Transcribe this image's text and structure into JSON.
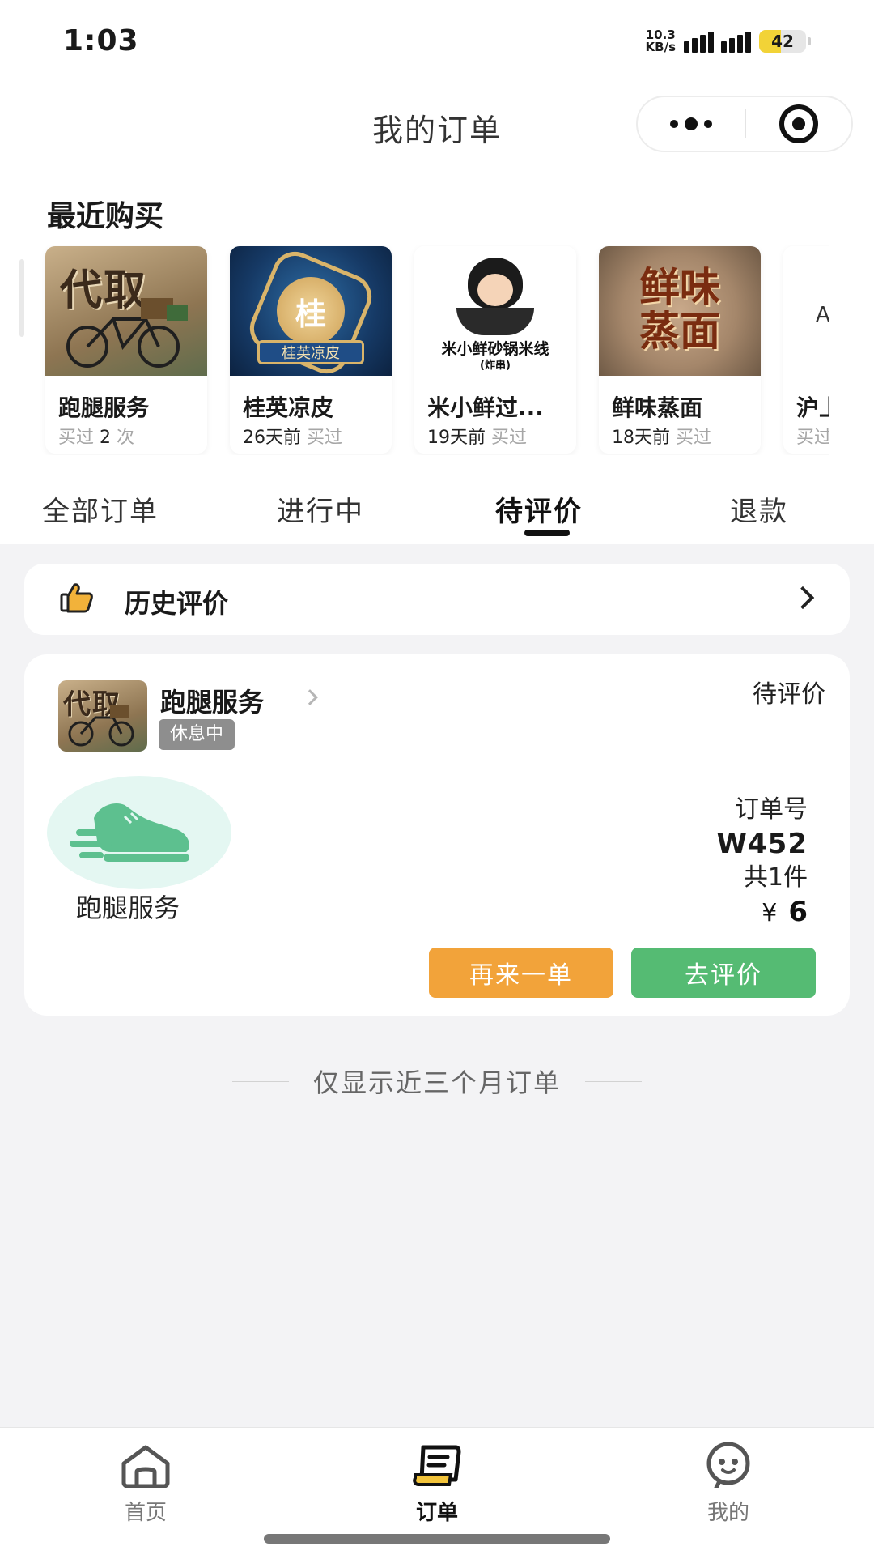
{
  "status_bar": {
    "time": "1:03",
    "net_speed_value": "10.3",
    "net_speed_unit": "KB/s",
    "battery": "42"
  },
  "header": {
    "title": "我的订单"
  },
  "recent": {
    "title": "最近购买",
    "items": [
      {
        "name": "跑腿服务",
        "meta_main": "",
        "meta_muted": "买过 ",
        "meta_count": "2",
        "meta_tail": " 次",
        "thumb_text": "代取"
      },
      {
        "name": "桂英凉皮",
        "meta_main": "26天前",
        "meta_muted": "买过",
        "thumb_text": "桂",
        "thumb_banner": "桂英凉皮"
      },
      {
        "name": "米小鲜过...",
        "meta_main": "19天前",
        "meta_muted": "买过",
        "thumb_text": "米小鲜砂锅米线",
        "thumb_sub": "(炸串)"
      },
      {
        "name": "鲜味蒸面",
        "meta_main": "18天前",
        "meta_muted": "买过",
        "thumb_text": "鲜味蒸面"
      },
      {
        "name": "沪上",
        "meta_main": "",
        "meta_muted": "买过"
      }
    ]
  },
  "tabs": [
    {
      "label": "全部订单"
    },
    {
      "label": "进行中"
    },
    {
      "label": "待评价"
    },
    {
      "label": "退款"
    }
  ],
  "history": {
    "label": "历史评价"
  },
  "order": {
    "shop_name": "跑腿服务",
    "shop_badge": "休息中",
    "shop_logo_text": "代取",
    "status": "待评价",
    "item_name": "跑腿服务",
    "order_no_label": "订单号",
    "order_no": "W452",
    "count": "共1件",
    "currency": "¥",
    "price": "6",
    "btn_reorder": "再来一单",
    "btn_review": "去评价"
  },
  "footer_note": "仅显示近三个月订单",
  "tabbar": [
    {
      "label": "首页",
      "icon": "home-icon"
    },
    {
      "label": "订单",
      "icon": "order-list-icon"
    },
    {
      "label": "我的",
      "icon": "profile-icon"
    }
  ],
  "colors": {
    "reorder": "#f2a33a",
    "review": "#55bb73",
    "badge": "#8e8e8e",
    "battery": "#f2d337"
  }
}
